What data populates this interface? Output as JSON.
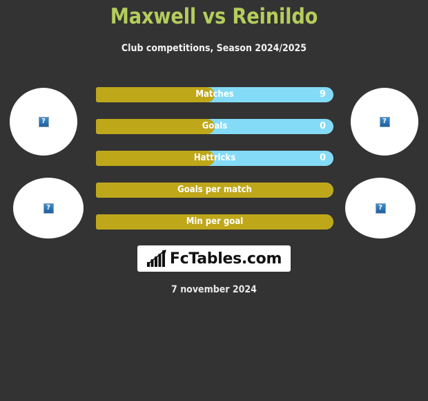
{
  "header": {
    "title": "Maxwell vs Reinildo",
    "subtitle": "Club competitions, Season 2024/2025",
    "title_color": "#b5cc5c"
  },
  "theme": {
    "background": "#333333",
    "bar_left_color": "#bfa71a",
    "bar_right_color": "#84dbf7",
    "text_color": "#ffffff"
  },
  "players": {
    "left": {
      "name": "Maxwell",
      "avatar_top": "broken-image-placeholder",
      "avatar_bottom": "broken-image-placeholder"
    },
    "right": {
      "name": "Reinildo",
      "avatar_top": "broken-image-placeholder",
      "avatar_bottom": "broken-image-placeholder"
    }
  },
  "placeholder_glyph": "?",
  "chart_data": {
    "type": "bar",
    "title": "Maxwell vs Reinildo",
    "subtitle": "Club competitions, Season 2024/2025",
    "categories": [
      "Matches",
      "Goals",
      "Hattricks",
      "Goals per match",
      "Min per goal"
    ],
    "series": [
      {
        "name": "Maxwell",
        "values": [
          "",
          "",
          "",
          "",
          ""
        ]
      },
      {
        "name": "Reinildo",
        "values": [
          "9",
          "0",
          "0",
          "",
          ""
        ]
      }
    ],
    "bar_fill_percent": [
      50,
      50,
      50,
      100,
      100
    ],
    "legend": "none",
    "grid": false
  },
  "stats": [
    {
      "label": "Matches",
      "left_value": "",
      "right_value": "9",
      "fill_percent": 50
    },
    {
      "label": "Goals",
      "left_value": "",
      "right_value": "0",
      "fill_percent": 50
    },
    {
      "label": "Hattricks",
      "left_value": "",
      "right_value": "0",
      "fill_percent": 50
    },
    {
      "label": "Goals per match",
      "left_value": "",
      "right_value": "",
      "fill_percent": 100
    },
    {
      "label": "Min per goal",
      "left_value": "",
      "right_value": "",
      "fill_percent": 100
    }
  ],
  "logo": {
    "text": "FcTables.com",
    "icon": "bar-chart-growth-icon"
  },
  "footer": {
    "date": "7 november 2024"
  }
}
